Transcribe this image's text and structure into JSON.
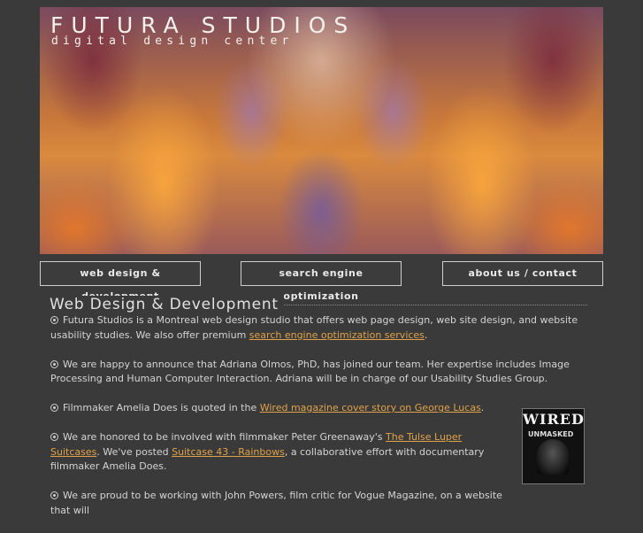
{
  "header": {
    "title": "FUTURA STUDIOS",
    "subtitle": "digital design center"
  },
  "nav": [
    {
      "label": "web design & development"
    },
    {
      "label": "search engine optimization"
    },
    {
      "label": "about us / contact"
    }
  ],
  "main": {
    "heading": "Web Design & Development",
    "p1_text": "Futura Studios is a Montreal web design studio that offers web page design, web site design, and website usability studies. We also offer premium ",
    "p1_link": "search engine optimization services",
    "p1_end": ".",
    "p2_text": "We are happy to announce that Adriana Olmos, PhD, has joined our team. Her expertise includes Image Processing and Human Computer Interaction. Adriana will be in charge of our Usability Studies Group.",
    "p3_text": "Filmmaker Amelia Does is quoted in the ",
    "p3_link": "Wired magazine cover story on George Lucas",
    "p3_end": ".",
    "p4_text": "We are honored to be involved with filmmaker Peter Greenaway's ",
    "p4_link": "The Tulse Luper Suitcases",
    "p4_mid": ". We've posted ",
    "p4_link2": "Suitcase 43 - Rainbows",
    "p4_end": ", a collaborative effort with documentary filmmaker Amelia Does.",
    "p5_text": "We are proud to be working with John Powers, film critic for Vogue Magazine, on a website that will"
  },
  "wired_cover": {
    "logo": "WIRED",
    "tag": "UNMASKED"
  }
}
